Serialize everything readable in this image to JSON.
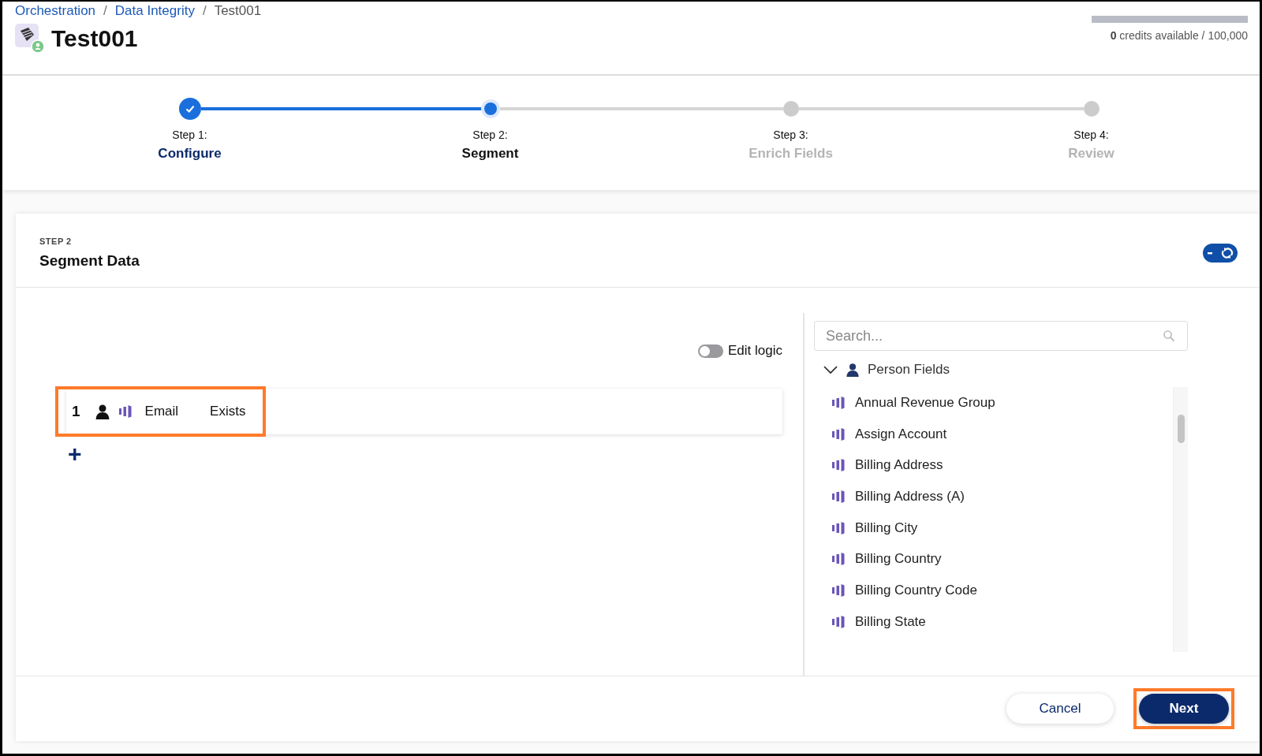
{
  "breadcrumb": [
    {
      "label": "Orchestration",
      "kind": "link"
    },
    {
      "label": "/",
      "kind": "separator"
    },
    {
      "label": "Data Integrity",
      "kind": "link"
    },
    {
      "label": "/",
      "kind": "separator"
    },
    {
      "label": "Test001",
      "kind": "current"
    }
  ],
  "page_title": "Test001",
  "credits": {
    "level": 0,
    "text": "**0** credits available / 100,000"
  },
  "steps": [
    {
      "label": "Step 1:",
      "name": "Configure",
      "completed": true,
      "selected": false
    },
    {
      "label": "Step 2:",
      "name": "Segment",
      "completed": false,
      "selected": true
    },
    {
      "label": "Step 3:",
      "name": "Enrich Fields",
      "completed": false,
      "selected": false
    },
    {
      "label": "Step 4:",
      "name": "Review",
      "completed": false,
      "selected": false
    }
  ],
  "card": {
    "eyebrow": "STEP 2",
    "title": "Segment Data",
    "sync_on": true
  },
  "edit_logic": {
    "label": "Edit logic",
    "on": false
  },
  "rules": [
    {
      "number": "1",
      "field": "Email",
      "operator": "Exists",
      "highlighted": true
    }
  ],
  "add_button": "+",
  "search": {
    "placeholder": "Search..."
  },
  "tree": {
    "label": "Person Fields",
    "expanded": true,
    "children": [
      {
        "label": "Annual Revenue Group"
      },
      {
        "label": "Assign Account"
      },
      {
        "label": "Billing Address"
      },
      {
        "label": "Billing Address (A)"
      },
      {
        "label": "Billing City"
      },
      {
        "label": "Billing Country"
      },
      {
        "label": "Billing Country Code"
      },
      {
        "label": "Billing State"
      }
    ]
  },
  "buttons": [
    {
      "label": "Cancel",
      "kind": "secondary",
      "highlighted": false
    },
    {
      "label": "Next",
      "kind": "primary",
      "highlighted": true
    }
  ]
}
